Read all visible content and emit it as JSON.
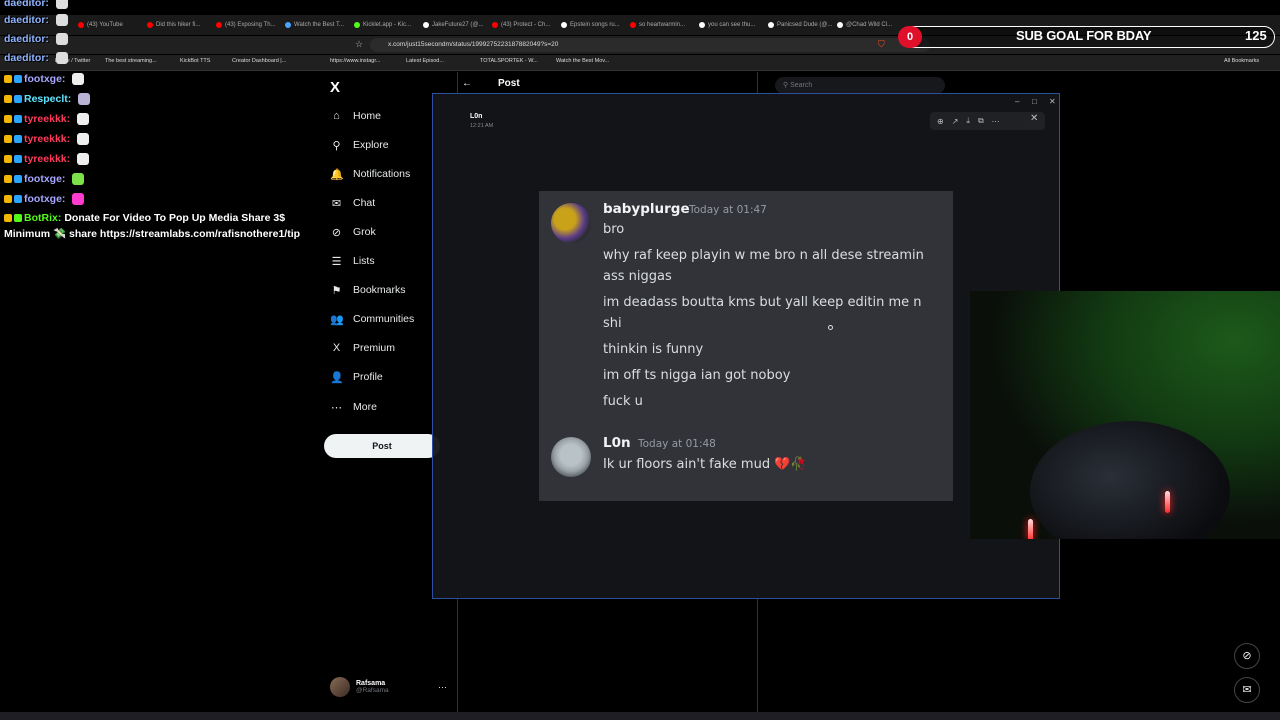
{
  "browser": {
    "tabs": [
      {
        "label": "(43) YouTube",
        "color": "#ff0000"
      },
      {
        "label": "Did this hiker fi...",
        "color": "#ff0000"
      },
      {
        "label": "(43) Exposing Th...",
        "color": "#ff0000"
      },
      {
        "label": "Watch the Best T...",
        "color": "#4aa3ff"
      },
      {
        "label": "Kicklet.app - Kic...",
        "color": "#53fc18"
      },
      {
        "label": "JakeFuture27 (@...",
        "color": "#ffffff"
      },
      {
        "label": "(43) Protect - Ch...",
        "color": "#ff0000"
      },
      {
        "label": "Epstein songs ru...",
        "color": "#ffffff"
      },
      {
        "label": "so heartwarmin...",
        "color": "#ff0000"
      },
      {
        "label": "you can see thu...",
        "color": "#ffffff"
      },
      {
        "label": "Panicsed Dude (@...",
        "color": "#ffffff"
      },
      {
        "label": "@Chad Wild Cl...",
        "color": "#ffffff"
      }
    ],
    "url": "x.com/just15secondm/status/1999275223187882049?s=20",
    "bookmarks": [
      "Home / Twitter",
      "The best streaming...",
      "KickBot TTS",
      "Creator Dashboard |...",
      "https://www.instagr...",
      "Latest Episod...",
      "TOTALSPORTEK - W...",
      "Watch the Best Mov...",
      "All Bookmarks"
    ]
  },
  "stream_chat": {
    "lines": [
      {
        "user": "daeditor:",
        "color": "#8fb4ff"
      },
      {
        "user": "daeditor:",
        "color": "#8fb4ff"
      },
      {
        "user": "daeditor:",
        "color": "#8fb4ff"
      },
      {
        "user": "daeditor:",
        "color": "#8fb4ff"
      },
      {
        "user": "footxge:",
        "color": "#a7a7ff"
      },
      {
        "user": "Respeclt:",
        "color": "#5fe6ff"
      },
      {
        "user": "tyreekkk:",
        "color": "#ff3b5c"
      },
      {
        "user": "tyreekkk:",
        "color": "#ff3b5c"
      },
      {
        "user": "tyreekkk:",
        "color": "#ff3b5c"
      },
      {
        "user": "footxge:",
        "color": "#a7a7ff"
      },
      {
        "user": "footxge:",
        "color": "#a7a7ff"
      },
      {
        "user": "BotRix:",
        "color": "#53fc18",
        "message": "Donate For Video To Pop Up Media Share 3$"
      },
      {
        "user": "",
        "color": "#ffffff",
        "message": "Minimum 💸 share https://streamlabs.com/rafisnothere1/tip"
      }
    ]
  },
  "sub_goal": {
    "current": "0",
    "title": "SUB GOAL FOR BDAY",
    "target": "125"
  },
  "x_sidebar": {
    "logo": "X",
    "items": [
      {
        "label": "Home",
        "icon": "home-icon",
        "glyph": "⌂"
      },
      {
        "label": "Explore",
        "icon": "search-icon",
        "glyph": "⚲"
      },
      {
        "label": "Notifications",
        "icon": "bell-icon",
        "glyph": "🔔"
      },
      {
        "label": "Chat",
        "icon": "chat-icon",
        "glyph": "✉"
      },
      {
        "label": "Grok",
        "icon": "grok-icon",
        "glyph": "⊘"
      },
      {
        "label": "Lists",
        "icon": "list-icon",
        "glyph": "☰"
      },
      {
        "label": "Bookmarks",
        "icon": "bookmark-icon",
        "glyph": "⚑"
      },
      {
        "label": "Communities",
        "icon": "communities-icon",
        "glyph": "👥"
      },
      {
        "label": "Premium",
        "icon": "premium-icon",
        "glyph": "X"
      },
      {
        "label": "Profile",
        "icon": "profile-icon",
        "glyph": "👤"
      },
      {
        "label": "More",
        "icon": "more-icon",
        "glyph": "⋯"
      }
    ],
    "post_button": "Post",
    "profile": {
      "name": "Rafsama",
      "handle": "@Rafsama"
    }
  },
  "x_main": {
    "back_icon": "←",
    "title": "Post",
    "search_placeholder": "Search"
  },
  "viewer": {
    "author": "L0n",
    "time": "12:21 AM"
  },
  "discord": {
    "messages": [
      {
        "user": "babyplurge",
        "time": "Today at 01:47",
        "avatar_color": "#c9a21a",
        "lines": [
          "bro",
          "why raf keep playin w me bro n all dese streamin ass niggas",
          "im deadass boutta kms but yall keep editin me n shi",
          "thinkin is funny",
          "im off ts nigga ian got noboy",
          "fuck u"
        ]
      },
      {
        "user": "L0n",
        "time": "Today at 01:48",
        "avatar_color": "#9aa3a8",
        "lines": [
          "Ik ur floors ain't fake mud 💔🥀"
        ]
      }
    ]
  },
  "colors": {
    "x_background": "#000000",
    "discord_background": "#313338",
    "viewer_border": "#2d4d9e",
    "sub_goal_accent": "#e0102a"
  }
}
